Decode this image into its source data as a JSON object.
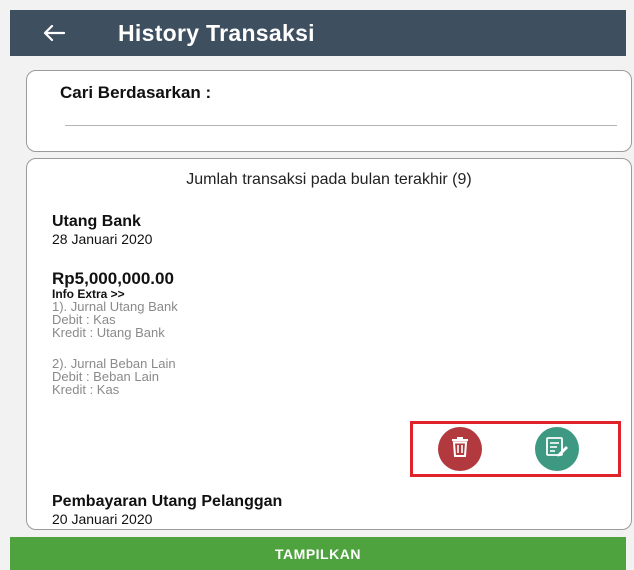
{
  "app_bar": {
    "back_icon": "arrow-left-icon",
    "title": "History Transaksi",
    "background": "#3e4f5f"
  },
  "search": {
    "label": "Cari Berdasarkan :"
  },
  "list": {
    "count_text": "Jumlah transaksi pada bulan terakhir (9)",
    "transactions": [
      {
        "title": "Utang Bank",
        "date": "28 Januari 2020",
        "amount": "Rp5,000,000.00",
        "info_extra": "Info Extra >>",
        "journals": [
          {
            "name": "1). Jurnal Utang Bank",
            "debit": "Debit  : Kas",
            "kredit": "Kredit : Utang Bank"
          },
          {
            "name": "2). Jurnal Beban Lain",
            "debit": "Debit  : Beban Lain",
            "kredit": "Kredit : Kas"
          }
        ]
      },
      {
        "title": "Pembayaran Utang Pelanggan",
        "date": "20 Januari 2020"
      }
    ]
  },
  "actions": {
    "delete_icon": "trash-icon",
    "edit_icon": "edit-document-icon",
    "delete_color": "#b23a3f",
    "edit_color": "#3d9981",
    "highlight_color": "#e0222a"
  },
  "bottom_button": {
    "label": "TAMPILKAN",
    "background": "#4ea33f"
  }
}
